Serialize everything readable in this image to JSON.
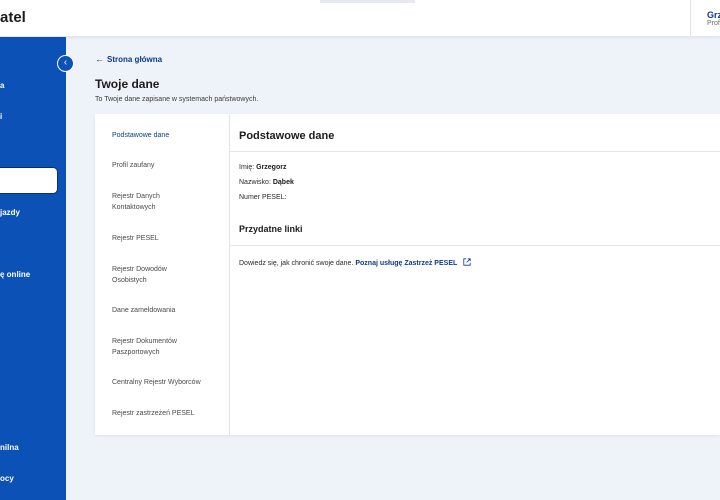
{
  "header": {
    "app_title_visible": "atel",
    "user_name_visible": "Grz",
    "user_sub_visible": "Prof"
  },
  "sidebar": {
    "items": [
      {
        "label": "a"
      },
      {
        "label": "i"
      },
      {
        "label": ""
      },
      {
        "label": "jazdy"
      },
      {
        "label": "ę online"
      },
      {
        "label": "nilna"
      },
      {
        "label": "ocy"
      }
    ]
  },
  "breadcrumb": {
    "back_label": "Strona główna"
  },
  "page": {
    "title": "Twoje dane",
    "subtitle": "To Twoje dane zapisane w systemach państwowych."
  },
  "menu": {
    "items": [
      {
        "label": "Podstawowe dane",
        "active": true
      },
      {
        "label": "Profil zaufany",
        "active": false
      },
      {
        "label": "Rejestr Danych Kontaktowych",
        "active": false
      },
      {
        "label": "Rejestr PESEL",
        "active": false
      },
      {
        "label": "Rejestr Dowodów Osobistych",
        "active": false
      },
      {
        "label": "Dane zameldowania",
        "active": false
      },
      {
        "label": "Rejestr Dokumentów Paszportowych",
        "active": false
      },
      {
        "label": "Centralny Rejestr Wyborców",
        "active": false
      },
      {
        "label": "Rejestr zastrzeżeń PESEL",
        "active": false
      }
    ]
  },
  "details": {
    "section_title": "Podstawowe dane",
    "first_name_label": "Imię:",
    "first_name_value": "Grzegorz",
    "last_name_label": "Nazwisko:",
    "last_name_value": "Dąbek",
    "pesel_label": "Numer PESEL:",
    "pesel_value": ""
  },
  "useful_links": {
    "title": "Przydatne linki",
    "text": "Dowiedz się, jak chronić swoje dane.",
    "link_label": "Poznaj usługę Zastrzeż PESEL"
  },
  "colors": {
    "brand_blue": "#0c51b5",
    "link_blue": "#0b3b8c",
    "page_bg": "#eef3f9"
  }
}
